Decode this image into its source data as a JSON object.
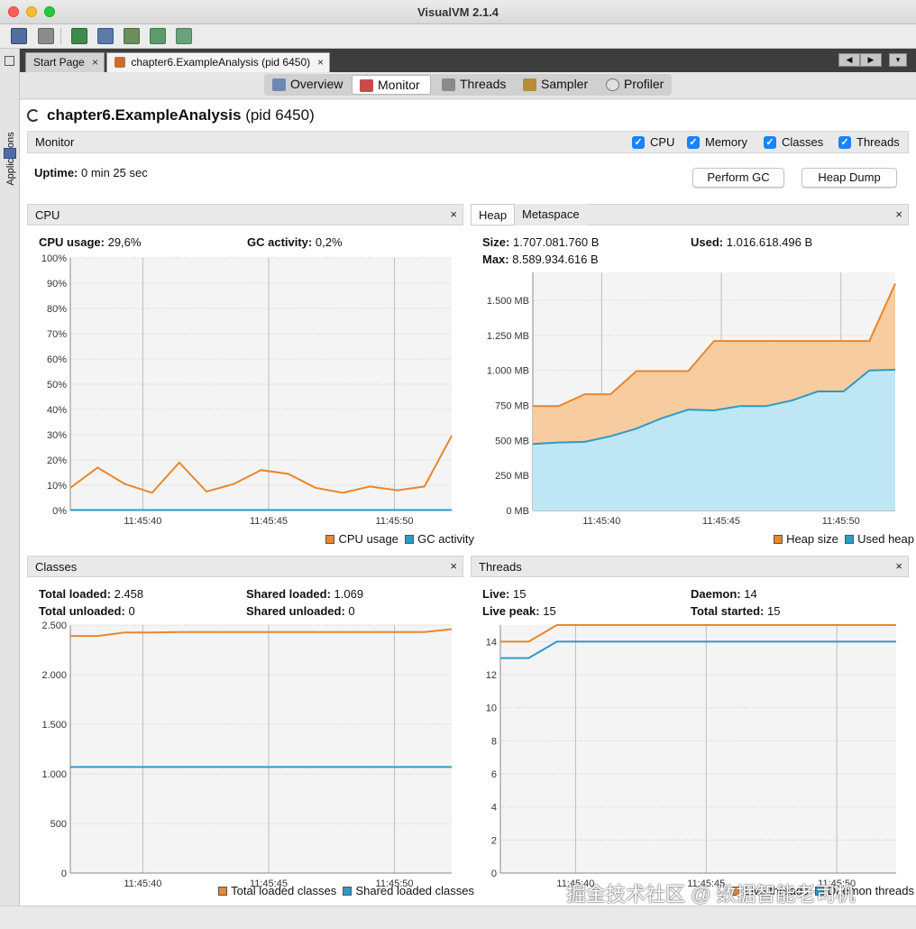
{
  "window": {
    "title": "VisualVM 2.1.4"
  },
  "left_panel": {
    "label": "Applications"
  },
  "doc_tabs": [
    {
      "label": "Start Page"
    },
    {
      "label": "chapter6.ExampleAnalysis (pid 6450)"
    }
  ],
  "view_tabs": [
    {
      "label": "Overview"
    },
    {
      "label": "Monitor",
      "active": true
    },
    {
      "label": "Threads"
    },
    {
      "label": "Sampler"
    },
    {
      "label": "Profiler"
    }
  ],
  "process": {
    "name": "chapter6.ExampleAnalysis",
    "pid": "(pid 6450)"
  },
  "monitor": {
    "label": "Monitor",
    "checks": [
      {
        "label": "CPU",
        "checked": true
      },
      {
        "label": "Memory",
        "checked": true
      },
      {
        "label": "Classes",
        "checked": true
      },
      {
        "label": "Threads",
        "checked": true
      }
    ],
    "uptime_label": "Uptime:",
    "uptime_value": "0 min 25 sec",
    "perform_gc": "Perform GC",
    "heap_dump": "Heap Dump"
  },
  "cpu_panel": {
    "title": "CPU",
    "close": "×",
    "cpu_usage_label": "CPU usage:",
    "cpu_usage_value": "29,6%",
    "gc_label": "GC activity:",
    "gc_value": "0,2%"
  },
  "heap_panel": {
    "tab_heap": "Heap",
    "tab_metaspace": "Metaspace",
    "close": "×",
    "size_label": "Size:",
    "size_value": "1.707.081.760 B",
    "used_label": "Used:",
    "used_value": "1.016.618.496 B",
    "max_label": "Max:",
    "max_value": "8.589.934.616 B"
  },
  "classes_panel": {
    "title": "Classes",
    "close": "×",
    "total_loaded_label": "Total loaded:",
    "total_loaded_value": "2.458",
    "shared_loaded_label": "Shared loaded:",
    "shared_loaded_value": "1.069",
    "total_unloaded_label": "Total unloaded:",
    "total_unloaded_value": "0",
    "shared_unloaded_label": "Shared unloaded:",
    "shared_unloaded_value": "0"
  },
  "threads_panel": {
    "title": "Threads",
    "close": "×",
    "live_label": "Live:",
    "live_value": "15",
    "daemon_label": "Daemon:",
    "daemon_value": "14",
    "peak_label": "Live peak:",
    "peak_value": "15",
    "started_label": "Total started:",
    "started_value": "15"
  },
  "watermark": "掘金技术社区 @ 数据智能老司机",
  "colors": {
    "orange": "#e8872e",
    "blue": "#2c9bc6",
    "orange_fill": "#f6cca0",
    "blue_fill": "#bfe6f4"
  },
  "chart_data": [
    {
      "type": "line",
      "id": "cpu",
      "x_ticks": [
        "11:45:40",
        "11:45:45",
        "11:45:50"
      ],
      "y_ticks": [
        "0%",
        "10%",
        "20%",
        "30%",
        "40%",
        "50%",
        "60%",
        "70%",
        "80%",
        "90%",
        "100%"
      ],
      "ylim": [
        0,
        100
      ],
      "x": [
        0,
        1,
        2,
        3,
        4,
        5,
        6,
        7,
        8,
        9,
        10,
        11,
        12,
        13,
        14
      ],
      "series": [
        {
          "name": "CPU usage",
          "color": "#e8872e",
          "values": [
            9,
            17,
            10.5,
            7,
            19,
            7.5,
            10.5,
            16,
            14.5,
            9,
            7,
            9.5,
            8,
            9.5,
            29.6
          ]
        },
        {
          "name": "GC activity",
          "color": "#2c9bc6",
          "values": [
            0.2,
            0.2,
            0.2,
            0.2,
            0.2,
            0.2,
            0.2,
            0.2,
            0.2,
            0.2,
            0.2,
            0.2,
            0.2,
            0.2,
            0.2
          ]
        }
      ],
      "legend": "bottom-right"
    },
    {
      "type": "area",
      "id": "heap",
      "x_ticks": [
        "11:45:40",
        "11:45:45",
        "11:45:50"
      ],
      "y_ticks": [
        "0 MB",
        "250 MB",
        "500 MB",
        "750 MB",
        "1.000 MB",
        "1.250 MB",
        "1.500 MB"
      ],
      "ylim": [
        0,
        1700
      ],
      "x": [
        0,
        1,
        2,
        3,
        4,
        5,
        6,
        7,
        8,
        9,
        10,
        11,
        12,
        13,
        14
      ],
      "series": [
        {
          "name": "Heap size",
          "color": "#e8872e",
          "values": [
            745,
            745,
            830,
            830,
            995,
            995,
            995,
            1210,
            1210,
            1210,
            1210,
            1210,
            1210,
            1210,
            1620
          ]
        },
        {
          "name": "Used heap",
          "color": "#2c9bc6",
          "values": [
            475,
            485,
            490,
            530,
            585,
            660,
            720,
            715,
            745,
            745,
            785,
            850,
            850,
            1000,
            1005
          ]
        }
      ],
      "legend": "bottom-right"
    },
    {
      "type": "line",
      "id": "classes",
      "x_ticks": [
        "11:45:40",
        "11:45:45",
        "11:45:50"
      ],
      "y_ticks": [
        "0",
        "500",
        "1.000",
        "1.500",
        "2.000",
        "2.500"
      ],
      "ylim": [
        0,
        2500
      ],
      "x": [
        0,
        1,
        2,
        3,
        4,
        5,
        6,
        7,
        8,
        9,
        10,
        11,
        12,
        13,
        14
      ],
      "series": [
        {
          "name": "Total loaded classes",
          "color": "#e8872e",
          "values": [
            2390,
            2390,
            2425,
            2425,
            2430,
            2430,
            2430,
            2430,
            2430,
            2430,
            2430,
            2430,
            2430,
            2430,
            2458
          ]
        },
        {
          "name": "Shared loaded classes",
          "color": "#2c9bc6",
          "values": [
            1069,
            1069,
            1069,
            1069,
            1069,
            1069,
            1069,
            1069,
            1069,
            1069,
            1069,
            1069,
            1069,
            1069,
            1069
          ]
        }
      ],
      "legend": "bottom-right"
    },
    {
      "type": "line",
      "id": "threads",
      "x_ticks": [
        "11:45:40",
        "11:45:45",
        "11:45:50"
      ],
      "y_ticks": [
        "0",
        "2",
        "4",
        "6",
        "8",
        "10",
        "12",
        "14"
      ],
      "ylim": [
        0,
        15
      ],
      "x": [
        0,
        1,
        2,
        3,
        4,
        5,
        6,
        7,
        8,
        9,
        10,
        11,
        12,
        13,
        14
      ],
      "series": [
        {
          "name": "Live threads",
          "color": "#e8872e",
          "values": [
            14,
            14,
            15,
            15,
            15,
            15,
            15,
            15,
            15,
            15,
            15,
            15,
            15,
            15,
            15
          ]
        },
        {
          "name": "Daemon threads",
          "color": "#2c9bc6",
          "values": [
            13,
            13,
            14,
            14,
            14,
            14,
            14,
            14,
            14,
            14,
            14,
            14,
            14,
            14,
            14
          ]
        }
      ],
      "legend": "bottom-right"
    }
  ]
}
